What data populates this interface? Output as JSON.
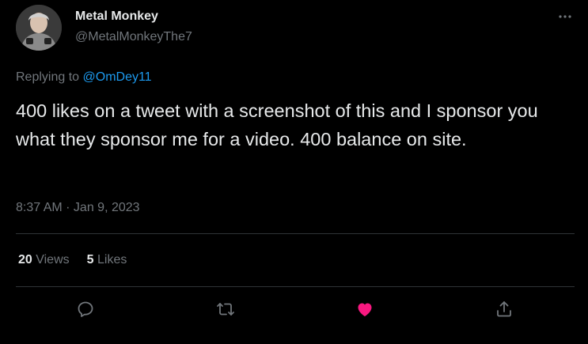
{
  "author": {
    "display_name": "Metal Monkey",
    "handle": "@MetalMonkeyThe7",
    "avatar_icon": "avatar-photo"
  },
  "more_icon": "more-dots-icon",
  "reply_context": {
    "prefix": "Replying to ",
    "mention": "@OmDey11"
  },
  "tweet": {
    "text": "400 likes on a tweet with a screenshot of this and I sponsor you what they sponsor me for a video. 400 balance on site.",
    "time": "8:37 AM",
    "separator": " · ",
    "date": "Jan 9, 2023"
  },
  "stats": {
    "views_count": "20",
    "views_label": " Views",
    "likes_count": "5",
    "likes_label": " Likes"
  },
  "actions": [
    {
      "name": "reply",
      "icon": "reply-icon"
    },
    {
      "name": "retweet",
      "icon": "retweet-icon"
    },
    {
      "name": "like",
      "icon": "heart-icon",
      "active": true
    },
    {
      "name": "share",
      "icon": "share-icon"
    }
  ],
  "colors": {
    "background": "#000000",
    "text": "#e7e9ea",
    "muted": "#71767b",
    "link": "#1d9bf0",
    "like_active": "#f91880",
    "divider": "#2f3336"
  }
}
